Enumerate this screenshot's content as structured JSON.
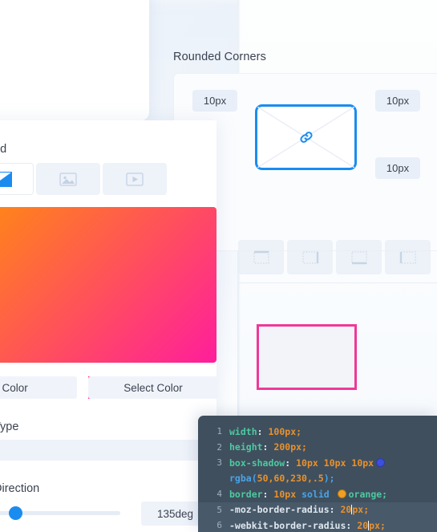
{
  "background_panel": {
    "section_label": "nd",
    "section_label_full": "Background",
    "tabs": [
      {
        "id": "gradient",
        "icon": "gradient-icon",
        "selected": true
      },
      {
        "id": "image",
        "icon": "image-icon",
        "selected": false
      },
      {
        "id": "video",
        "icon": "video-icon",
        "selected": false
      }
    ],
    "gradient_preview": {
      "from_color": "#FF9800",
      "to_color": "#FF1E9C",
      "angle": "135deg"
    },
    "color_buttons": [
      {
        "label": "Select Color",
        "swatch": ""
      },
      {
        "label": "Select Color",
        "swatch": "#FF2AA0"
      }
    ],
    "type_label": "Type",
    "type_value": "",
    "direction_label": "Direction",
    "direction_value": "135deg",
    "slider_percent": 17
  },
  "rounded_corners_panel": {
    "title": "Rounded Corners",
    "badges": [
      "10px",
      "10px",
      "10px"
    ],
    "preview": {
      "border_color": "#1A8CF0",
      "icon": "link-icon"
    },
    "side_buttons": [
      {
        "id": "top",
        "icon": "border-top-icon"
      },
      {
        "id": "right",
        "icon": "border-right-icon"
      },
      {
        "id": "bottom",
        "icon": "border-bottom-icon"
      },
      {
        "id": "left",
        "icon": "border-left-icon"
      }
    ],
    "result_box": {
      "border_color": "#EF3897",
      "fill_color": "#F2F4F9"
    }
  },
  "code_editor": {
    "lines": [
      {
        "n": "1",
        "highlighted": false
      },
      {
        "n": "2",
        "highlighted": false
      },
      {
        "n": "3",
        "highlighted": false
      },
      {
        "n": "",
        "highlighted": false
      },
      {
        "n": "4",
        "highlighted": false
      },
      {
        "n": "5",
        "highlighted": true
      },
      {
        "n": "6",
        "highlighted": true
      }
    ],
    "code": {
      "l1_prop": "width",
      "l1_val": "100px",
      "l2_prop": "height",
      "l2_val": "200px",
      "l3_prop": "box-shadow",
      "l3_v1": "10px",
      "l3_v2": "10px",
      "l3_v3": "10px",
      "l3b_fn": "rgba",
      "l3b_args": "50,60,230,.5",
      "l4_prop": "border",
      "l4_v1": "10px",
      "l4_kw": "solid",
      "l4_val": "orange",
      "l5_prop": "-moz-border-radius",
      "l5_val_a": "20",
      "l5_val_b": "px",
      "l6_prop": "-webkit-border-radius",
      "l6_val_a": "20",
      "l6_val_b": "px"
    },
    "swatches": {
      "shadow_color": "#3C4FE0",
      "border_color": "#F0A020"
    },
    "semicolon": ";",
    "colon": ":",
    "paren_open": "(",
    "paren_close": ")"
  }
}
